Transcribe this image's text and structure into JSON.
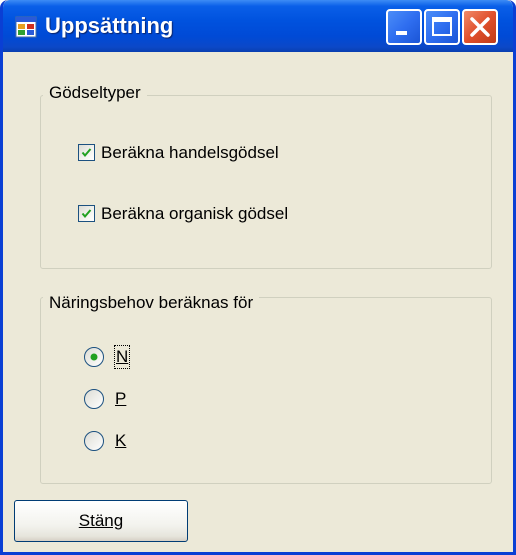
{
  "window": {
    "title": "Uppsättning",
    "app_icon": "form-window-icon",
    "controls": [
      "minimize-icon",
      "maximize-icon",
      "close-icon"
    ]
  },
  "fertilizer_group": {
    "legend": "Gödseltyper",
    "checkboxes": [
      {
        "label": "Beräkna handelsgödsel",
        "checked": true
      },
      {
        "label": "Beräkna organisk gödsel",
        "checked": true
      }
    ]
  },
  "nutrient_group": {
    "legend": "Näringsbehov beräknas för",
    "options": [
      {
        "label": "N",
        "selected": true
      },
      {
        "label": "P",
        "selected": false
      },
      {
        "label": "K",
        "selected": false
      }
    ]
  },
  "footer": {
    "close_button_label": "Stäng"
  },
  "colors": {
    "titlebar": "#0052de",
    "dialog_background": "#ece9d8",
    "close_control": "#e0502c",
    "check_mark": "#21a121"
  }
}
